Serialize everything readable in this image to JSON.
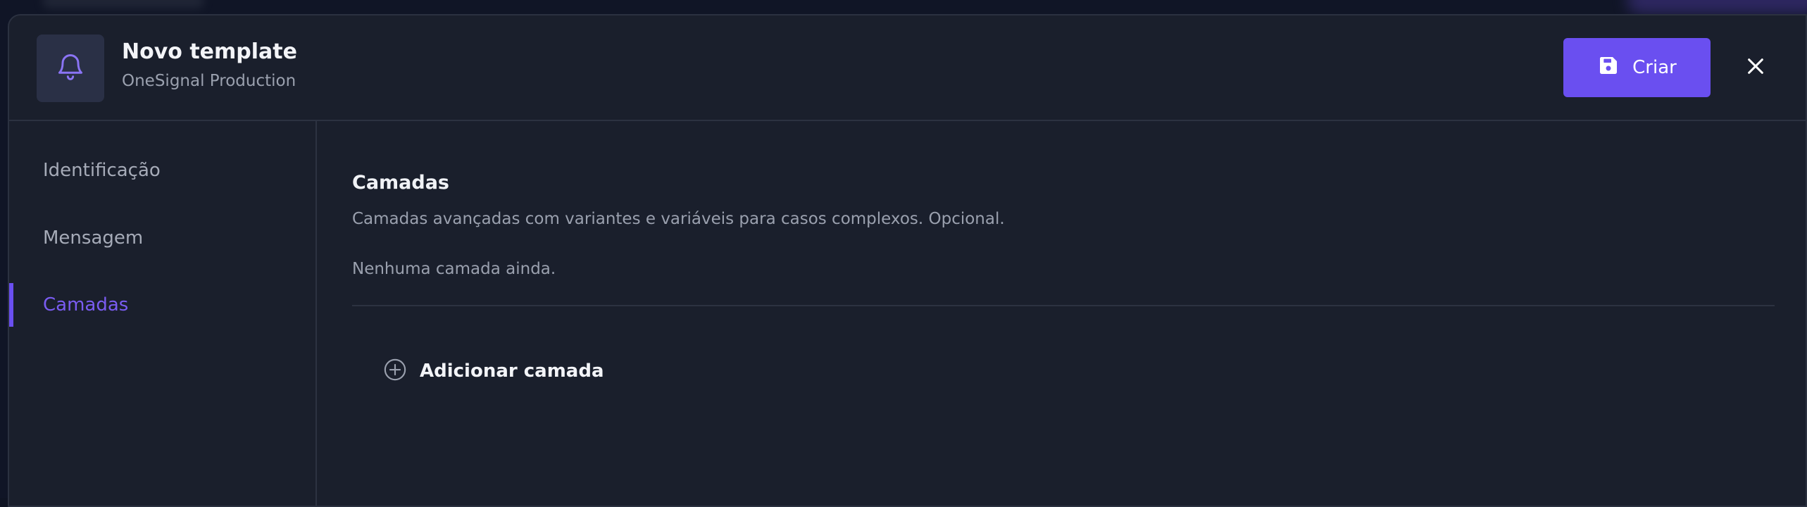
{
  "header": {
    "title": "Novo template",
    "subtitle": "OneSignal Production",
    "avatar_icon": "bell-icon",
    "create_label": "Criar",
    "create_icon": "save-icon",
    "close_icon": "close-icon"
  },
  "sidebar": {
    "items": [
      {
        "label": "Identificação",
        "active": false
      },
      {
        "label": "Mensagem",
        "active": false
      },
      {
        "label": "Camadas",
        "active": true
      }
    ]
  },
  "main": {
    "section_title": "Camadas",
    "description": "Camadas avançadas com variantes e variáveis para casos complexos. Opcional.",
    "empty_text": "Nenhuma camada ainda.",
    "add_label": "Adicionar camada",
    "add_icon": "plus-circle-icon"
  },
  "colors": {
    "accent": "#6a4ff0",
    "active_text": "#7a5cf2",
    "background": "#1a1f2c",
    "border": "#2c3241",
    "text_primary": "#f3f4f8",
    "text_secondary": "#9aa0ae"
  }
}
